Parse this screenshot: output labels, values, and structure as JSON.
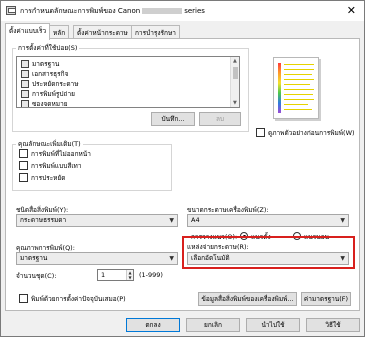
{
  "window": {
    "title_prefix": "การกำหนดลักษณะการพิมพ์ของ Canon",
    "title_suffix": "series",
    "close_glyph": "✕"
  },
  "tabs": [
    {
      "label": "ตั้งค่าแบบเร็ว",
      "active": true
    },
    {
      "label": "หลัก",
      "active": false
    },
    {
      "label": "ตั้งค่าหน้ากระดาษ",
      "active": false
    },
    {
      "label": "การบำรุงรักษา",
      "active": false
    }
  ],
  "common_settings": {
    "label": "การตั้งค่าที่ใช้บ่อย(S)",
    "items": [
      {
        "label": "มาตรฐาน",
        "icon": "printer-standard-icon"
      },
      {
        "label": "เอกสารธุรกิจ",
        "icon": "business-document-icon"
      },
      {
        "label": "ประหยัดกระดาษ",
        "icon": "paper-saving-icon"
      },
      {
        "label": "การพิมพ์รูปถ่าย",
        "icon": "photo-print-icon"
      },
      {
        "label": "ซองจดหมาย",
        "icon": "envelope-icon"
      }
    ],
    "save_button": "บันทึก...",
    "delete_button": "ลบ"
  },
  "preview": {
    "always_print_with_preview": "ดูภาพตัวอย่างก่อนการพิมพ์(W)"
  },
  "additional_features": {
    "label": "คุณลักษณะเพิ่มเติม(T)",
    "options": [
      {
        "label": "การพิมพ์ที่ไม่ออกหน้า",
        "checked": false
      },
      {
        "label": "การพิมพ์แบบสีเทา",
        "checked": false
      },
      {
        "label": "การประหยัด",
        "checked": false
      }
    ]
  },
  "media_type": {
    "label": "ชนิดสื่อสิ่งพิมพ์(Y):",
    "value": "กระดาษธรรมดา"
  },
  "printer_paper_size": {
    "label": "ขนาดกระดาษเครื่องพิมพ์(Z):",
    "value": "A4"
  },
  "orientation": {
    "label": "การวางแนว(O):",
    "portrait": "แนวตั้ง",
    "landscape": "แนวนอน",
    "selected": "portrait"
  },
  "print_quality": {
    "label": "คุณภาพการพิมพ์(Q):",
    "value": "มาตรฐาน"
  },
  "paper_source": {
    "label": "แหล่งจ่ายกระดาษ(R):",
    "value": "เลือกอัตโนมัติ"
  },
  "copies": {
    "label": "จำนวนชุด(C):",
    "value": "1",
    "range": "(1-999)"
  },
  "footer_options": {
    "always_print_label": "พิมพ์ด้วยการตั้งค่าปัจจุบันเสมอ(P)",
    "printer_media_info_button": "ข้อมูลสื่อสิ่งพิมพ์ของเครื่องพิมพ์...",
    "defaults_button": "ค่ามาตรฐาน(F)"
  },
  "dialog_buttons": {
    "ok": "ตกลง",
    "cancel": "ยกเลิก",
    "apply": "นำไปใช้",
    "help": "วิธีใช้"
  },
  "colors": {
    "highlight_box": "#d8201d",
    "default_button_border": "#0078d7"
  }
}
